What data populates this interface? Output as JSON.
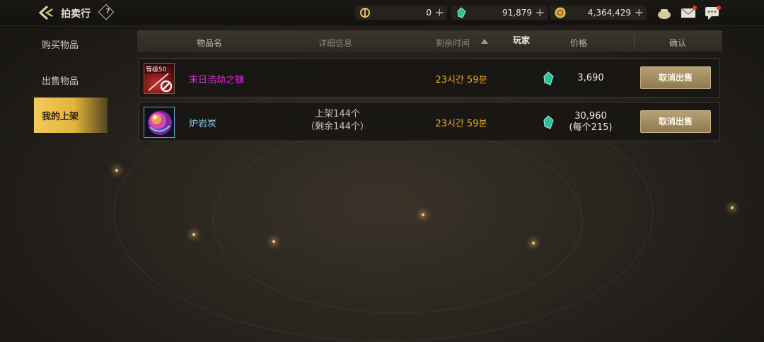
{
  "header": {
    "title": "拍卖行",
    "help": "?"
  },
  "currencies": [
    {
      "name": "coupon",
      "icon": "coupon-icon",
      "value": "0"
    },
    {
      "name": "gem",
      "icon": "gem-icon",
      "value": "91,879"
    },
    {
      "name": "gold",
      "icon": "gold-coin-icon",
      "value": "4,364,429"
    }
  ],
  "sidebar": {
    "items": [
      {
        "label": "购买物品"
      },
      {
        "label": "出售物品"
      },
      {
        "label": "我的上架"
      }
    ]
  },
  "table": {
    "columns": {
      "name": "物品名",
      "detail": "详细信息",
      "time": "剩余时间",
      "player": "玩家",
      "price": "价格",
      "confirm": "确认"
    },
    "rows": [
      {
        "icon_badge": "等级50",
        "name": "末日浩劫之镰",
        "name_color": "#e024e0",
        "detail_1": "",
        "detail_2": "",
        "time": "23시간 59분",
        "price": "3,690",
        "price_sub": "",
        "action": "取消出售"
      },
      {
        "icon_badge": "",
        "name": "炉岩炭",
        "name_color": "#7ec8e8",
        "detail_1": "上架144个",
        "detail_2": "（剩余144个）",
        "time": "23시간 59분",
        "price": "30,960",
        "price_sub": "(每个215)",
        "action": "取消出售"
      }
    ]
  },
  "colors": {
    "accent": "#e3b33a",
    "time_text": "#eaa624",
    "button": "#a08a60"
  }
}
